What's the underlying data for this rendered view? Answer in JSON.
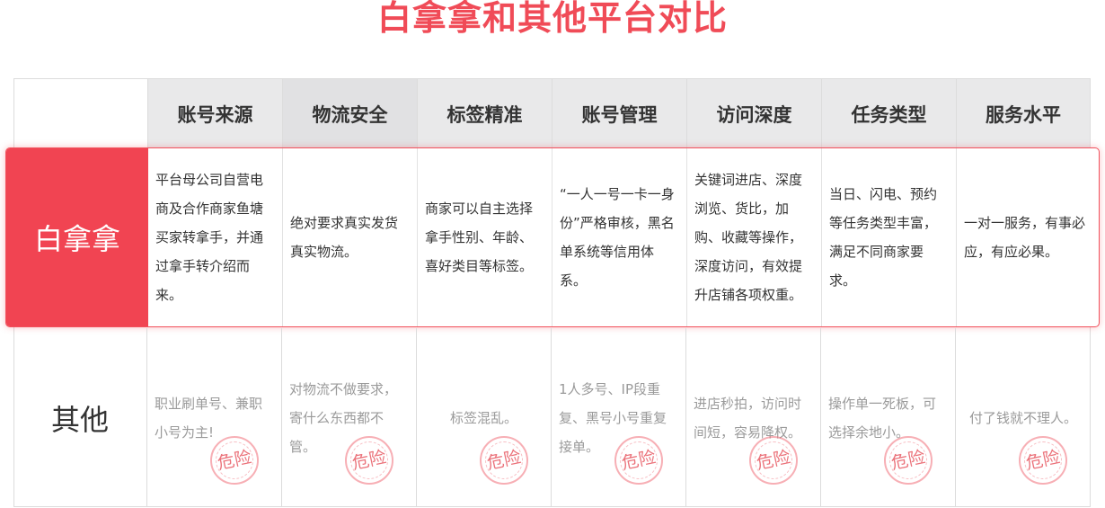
{
  "title": "白拿拿和其他平台对比",
  "headers": [
    "账号来源",
    "物流安全",
    "标签精准",
    "账号管理",
    "访问深度",
    "任务类型",
    "服务水平"
  ],
  "main_row": {
    "label": "白拿拿",
    "cells": [
      "平台母公司自营电商及合作商家鱼塘买家转拿手，并通过拿手转介绍而来。",
      "绝对要求真实发货真实物流。",
      "商家可以自主选择拿手性别、年龄、喜好类目等标签。",
      "“一人一号一卡一身份”严格审核，黑名单系统等信用体系。",
      "关键词进店、深度浏览、货比，加购、收藏等操作，深度访问，有效提升店铺各项权重。",
      "当日、闪电、预约等任务类型丰富，满足不同商家要求。",
      "一对一服务，有事必应，有应必果。"
    ]
  },
  "other_row": {
    "label": "其他",
    "cells": [
      "职业刷单号、兼职小号为主!",
      "对物流不做要求，寄什么东西都不管。",
      "标签混乱。",
      "1人多号、IP段重复、黑号小号重复接单。",
      "进店秒拍，访问时间短，容易降权。",
      "操作单一死板，可选择余地小。",
      "付了钱就不理人。"
    ],
    "stamp_text": "危险"
  }
}
